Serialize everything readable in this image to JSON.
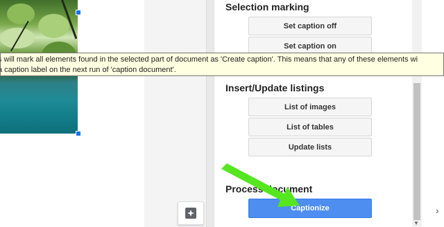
{
  "panel": {
    "selection_heading": "Selection marking",
    "set_caption_off": "Set caption off",
    "set_caption_on": "Set caption on",
    "listings_heading": "Insert/Update listings",
    "list_of_images": "List of images",
    "list_of_tables": "List of tables",
    "update_lists": "Update lists",
    "process_heading": "Process document",
    "captionize": "Captionize"
  },
  "tooltip": {
    "line1": "s will mark all elements found in the selected part of document as 'Create caption'. This means that any of these elements wi",
    "line2": "a caption label on the next run of 'caption document'."
  },
  "icons": {
    "explore": "explore-icon",
    "scroll_down": "scroll-down-arrow-icon",
    "side_expand": "chevron-right-icon"
  },
  "colors": {
    "primary_button": "#4d8ef0",
    "tooltip_bg": "#ffffe1",
    "annotation_arrow": "#55e620"
  }
}
